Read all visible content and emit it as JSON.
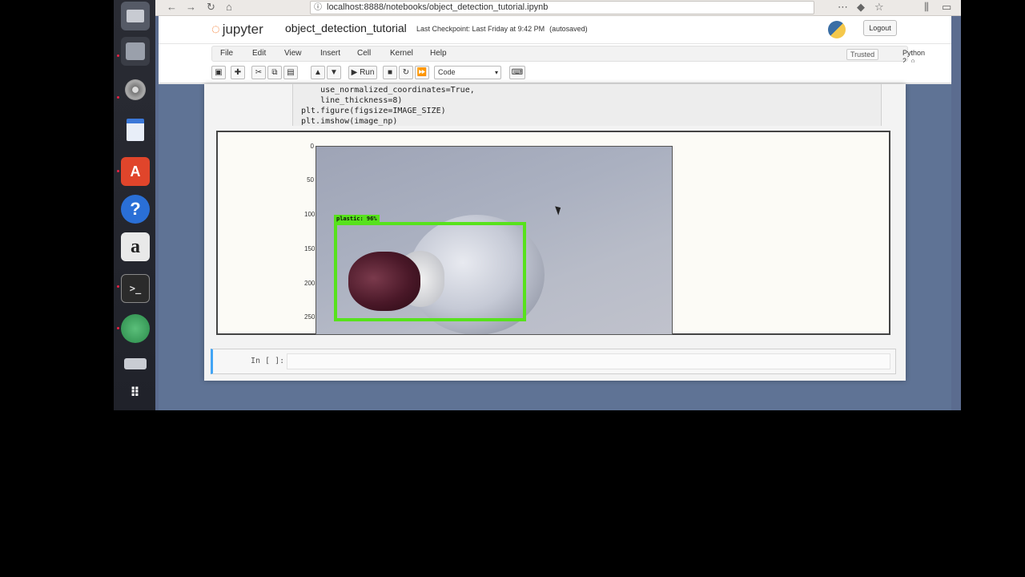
{
  "browser": {
    "url": "localhost:8888/notebooks/object_detection_tutorial.ipynb"
  },
  "launcher": {
    "icons": [
      "files-icon",
      "storage-icon",
      "disk-icon",
      "document-icon",
      "software-center-icon",
      "help-icon",
      "amazon-icon",
      "terminal-icon",
      "globe-icon",
      "drive-icon",
      "apps-grid-icon"
    ],
    "software_center_letter": "A",
    "help_glyph": "?",
    "amazon_letter": "a"
  },
  "jupyter": {
    "logo_text": "jupyter",
    "notebook_name": "object_detection_tutorial",
    "checkpoint": "Last Checkpoint: Last Friday at 9:42 PM",
    "autosaved": "(autosaved)",
    "logout_label": "Logout",
    "menu": [
      "File",
      "Edit",
      "View",
      "Insert",
      "Cell",
      "Kernel",
      "Help"
    ],
    "trusted_label": "Trusted",
    "kernel_label": "Python 2",
    "toolbar": {
      "run_label": "Run",
      "cell_type": "Code"
    }
  },
  "code_cell": {
    "lines": [
      "    use_normalized_coordinates=True,",
      "    line_thickness=8)",
      "plt.figure(figsize=IMAGE_SIZE)",
      "plt.imshow(image_np)"
    ]
  },
  "output": {
    "y_ticks": [
      "0",
      "50",
      "100",
      "150",
      "200",
      "250"
    ],
    "detection_label": "plastic: 96%",
    "box_color": "#57e21c"
  },
  "input_cell": {
    "prompt": "In [ ]:"
  }
}
